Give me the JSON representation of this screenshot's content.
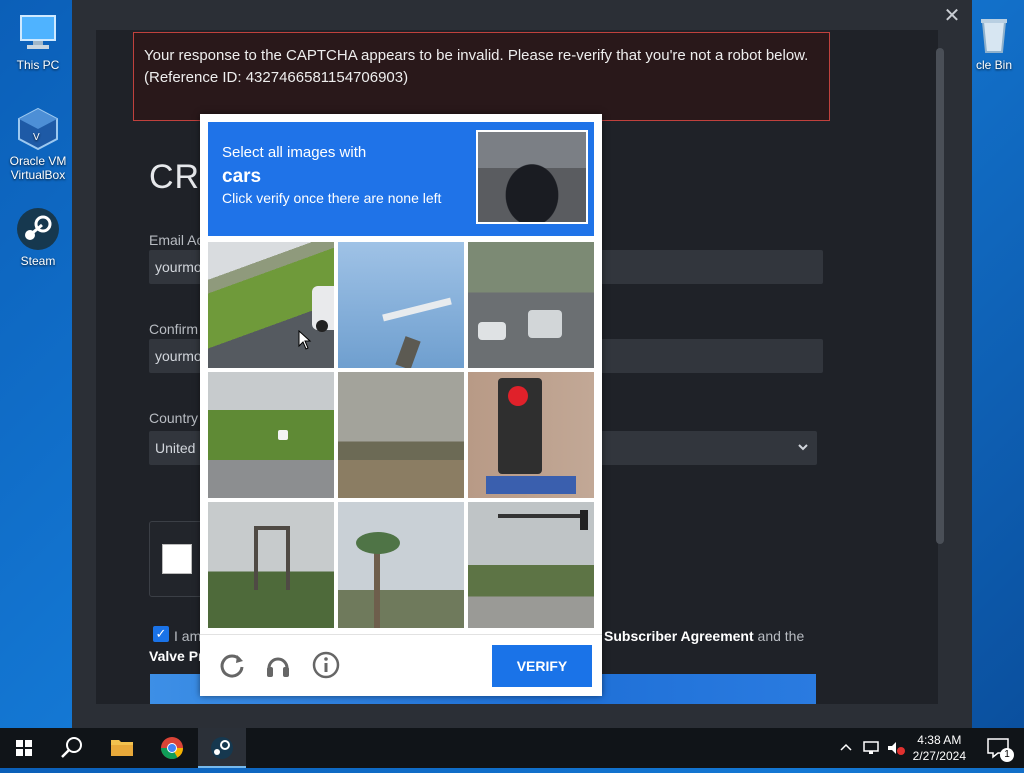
{
  "desktop": {
    "icons": [
      {
        "label": "This PC",
        "icon": "monitor-icon"
      },
      {
        "label": "Oracle VM VirtualBox",
        "icon": "virtualbox-icon"
      },
      {
        "label": "Steam",
        "icon": "steam-icon"
      },
      {
        "label": "cle Bin",
        "icon": "recycle-bin-icon"
      }
    ]
  },
  "window": {
    "close_glyph": "✕",
    "error": {
      "line1": "Your response to the CAPTCHA appears to be invalid. Please re-verify that you're not a robot below.",
      "line2": "(Reference ID: 4327466581154706903)"
    },
    "page_title": "CRI",
    "email_label": "Email Ac",
    "email_value": "yourmo",
    "confirm_label": "Confirm",
    "confirm_value": "yourmo",
    "country_label": "Country",
    "country_value": "United",
    "agree_start": "I am",
    "agree_link": "Subscriber Agreement",
    "agree_end": " and the",
    "agree_line2": "Valve Pr"
  },
  "captcha": {
    "prompt_prefix": "Select all images with",
    "target": "cars",
    "instruction": "Click verify once there are none left",
    "tiles": [
      {
        "subject": "highway-with-car"
      },
      {
        "subject": "sky-with-crane"
      },
      {
        "subject": "street-with-cars"
      },
      {
        "subject": "rural-road-with-car"
      },
      {
        "subject": "open-field"
      },
      {
        "subject": "traffic-light"
      },
      {
        "subject": "tower-in-trees"
      },
      {
        "subject": "palm-trees-power-lines"
      },
      {
        "subject": "intersection-traffic-light"
      }
    ],
    "verify_label": "VERIFY"
  },
  "taskbar": {
    "time": "4:38 AM",
    "date": "2/27/2024",
    "notification_count": "1"
  }
}
